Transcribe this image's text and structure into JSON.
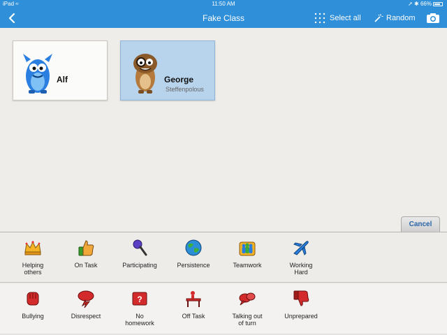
{
  "status": {
    "device": "iPad",
    "time": "11:50 AM",
    "battery": "66%"
  },
  "nav": {
    "title": "Fake Class",
    "select_all": "Select all",
    "random": "Random"
  },
  "students": [
    {
      "name": "Alf",
      "subname": ""
    },
    {
      "name": "George",
      "subname": "Steffenpolous"
    }
  ],
  "cancel_label": "Cancel",
  "positive_behaviors": [
    {
      "label": "Helping\nothers",
      "icon": "crown-icon"
    },
    {
      "label": "On Task",
      "icon": "thumbs-up-icon"
    },
    {
      "label": "Participating",
      "icon": "microphone-icon"
    },
    {
      "label": "Persistence",
      "icon": "globe-icon"
    },
    {
      "label": "Teamwork",
      "icon": "team-icon"
    },
    {
      "label": "Working\nHard",
      "icon": "airplane-icon"
    }
  ],
  "negative_behaviors": [
    {
      "label": "Bullying",
      "icon": "fist-icon"
    },
    {
      "label": "Disrespect",
      "icon": "storm-cloud-icon"
    },
    {
      "label": "No\nhomework",
      "icon": "question-book-icon"
    },
    {
      "label": "Off Task",
      "icon": "desk-icon"
    },
    {
      "label": "Talking out\nof turn",
      "icon": "speech-bubble-icon"
    },
    {
      "label": "Unprepared",
      "icon": "thumbs-down-icon"
    }
  ],
  "colors": {
    "brand": "#2f8fd8",
    "selected_card": "#b8d3ec",
    "negative_icon": "#d32b2b"
  }
}
